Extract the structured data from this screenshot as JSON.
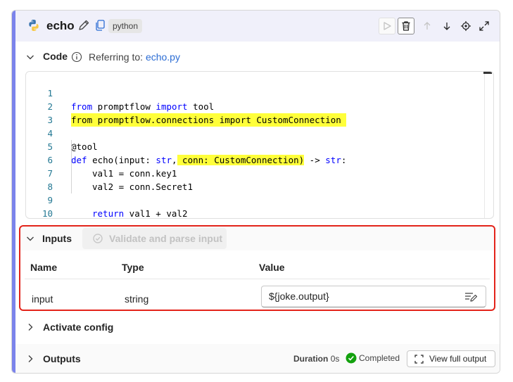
{
  "node": {
    "title": "echo",
    "language": "python"
  },
  "code_section": {
    "label": "Code",
    "referring_prefix": "Referring to:",
    "referring_file": "echo.py"
  },
  "code": {
    "line_numbers": [
      "1",
      "2",
      "3",
      "4",
      "5",
      "6",
      "7",
      "8",
      "9",
      "10"
    ],
    "line1_kw1": "from",
    "line1_mod": " promptflow ",
    "line1_kw2": "import",
    "line1_rest": " tool",
    "line2": "from promptflow.connections import CustomConnection ",
    "line4": "@tool",
    "line5_kw": "def",
    "line5_a": " echo(input: ",
    "line5_str": "str",
    "line5_b": ",",
    "line5_hl": " conn: CustomConnection)",
    "line5_c": " -> ",
    "line5_str2": "str",
    "line5_d": ":",
    "line6": "val1 = conn.key1",
    "line7": "val2 = conn.Secret1",
    "line9_kw": "return",
    "line9_rest": " val1 + val2"
  },
  "inputs_section": {
    "label": "Inputs",
    "validate_label": "Validate and parse input",
    "columns": {
      "name": "Name",
      "type": "Type",
      "value": "Value"
    },
    "rows": [
      {
        "name": "input",
        "type": "string",
        "value": "${joke.output}"
      }
    ]
  },
  "activate_section": {
    "label": "Activate config"
  },
  "outputs_section": {
    "label": "Outputs",
    "duration_label": "Duration",
    "duration_value": "0s",
    "status": "Completed",
    "view_full_label": "View full output"
  },
  "colors": {
    "accent": "#7b83eb",
    "highlight": "#ffff3a",
    "inputs_border": "#e3231a",
    "status_green": "#13a10e",
    "link": "#2b6cd4"
  }
}
